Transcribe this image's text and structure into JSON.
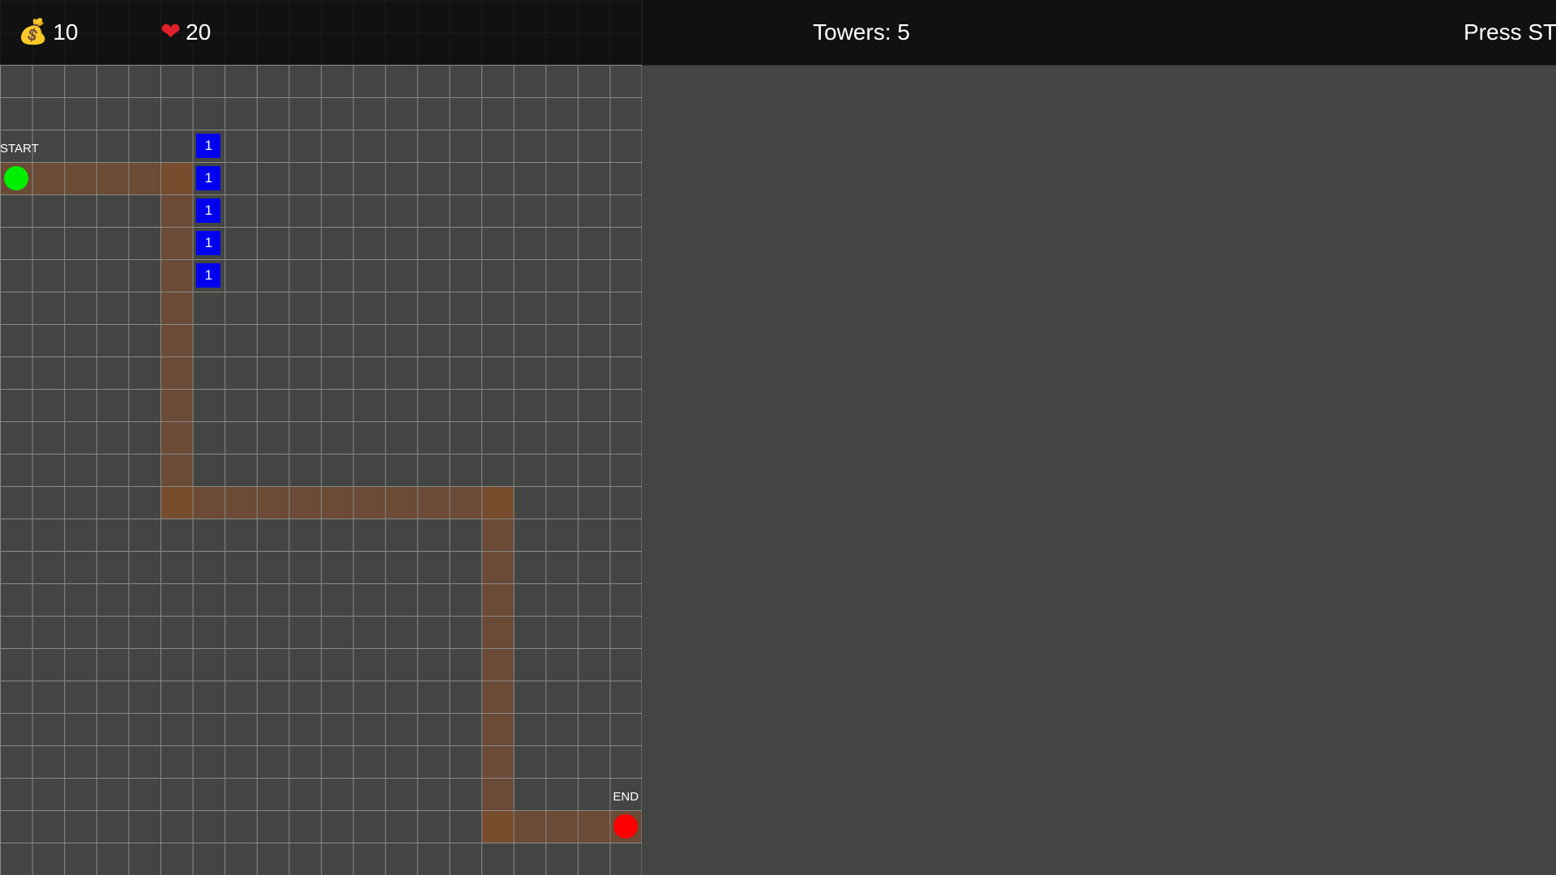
{
  "hud": {
    "gold_icon": "money-bag-icon",
    "gold": "10",
    "lives_icon": "heart-icon",
    "lives": "20",
    "towers_text": "Towers: 5",
    "prompt_text": "Press ST"
  },
  "map": {
    "columns": 20,
    "rows": 25,
    "start_label": "START",
    "end_label": "END",
    "start_color": "#00ee00",
    "end_color": "#ff0000",
    "path_color": "#6b4a36",
    "path_corner_color": "#774d2e",
    "path_cells": [
      [
        0,
        3
      ],
      [
        1,
        3
      ],
      [
        2,
        3
      ],
      [
        3,
        3
      ],
      [
        4,
        3
      ],
      [
        5,
        3
      ],
      [
        5,
        4
      ],
      [
        5,
        5
      ],
      [
        5,
        6
      ],
      [
        5,
        7
      ],
      [
        5,
        8
      ],
      [
        5,
        9
      ],
      [
        5,
        10
      ],
      [
        5,
        11
      ],
      [
        5,
        12
      ],
      [
        5,
        13
      ],
      [
        6,
        13
      ],
      [
        7,
        13
      ],
      [
        8,
        13
      ],
      [
        9,
        13
      ],
      [
        10,
        13
      ],
      [
        11,
        13
      ],
      [
        12,
        13
      ],
      [
        13,
        13
      ],
      [
        14,
        13
      ],
      [
        15,
        13
      ],
      [
        15,
        14
      ],
      [
        15,
        15
      ],
      [
        15,
        16
      ],
      [
        15,
        17
      ],
      [
        15,
        18
      ],
      [
        15,
        19
      ],
      [
        15,
        20
      ],
      [
        15,
        21
      ],
      [
        15,
        22
      ],
      [
        15,
        23
      ],
      [
        16,
        23
      ],
      [
        17,
        23
      ],
      [
        18,
        23
      ],
      [
        19,
        23
      ]
    ],
    "corner_cells": [
      [
        5,
        3
      ],
      [
        5,
        13
      ],
      [
        15,
        13
      ],
      [
        15,
        23
      ]
    ],
    "start_cell": [
      0,
      3
    ],
    "end_cell": [
      19,
      23
    ],
    "towers": [
      {
        "cell": [
          6,
          2
        ],
        "level": "1"
      },
      {
        "cell": [
          6,
          3
        ],
        "level": "1"
      },
      {
        "cell": [
          6,
          4
        ],
        "level": "1"
      },
      {
        "cell": [
          6,
          5
        ],
        "level": "1"
      },
      {
        "cell": [
          6,
          6
        ],
        "level": "1"
      }
    ]
  }
}
